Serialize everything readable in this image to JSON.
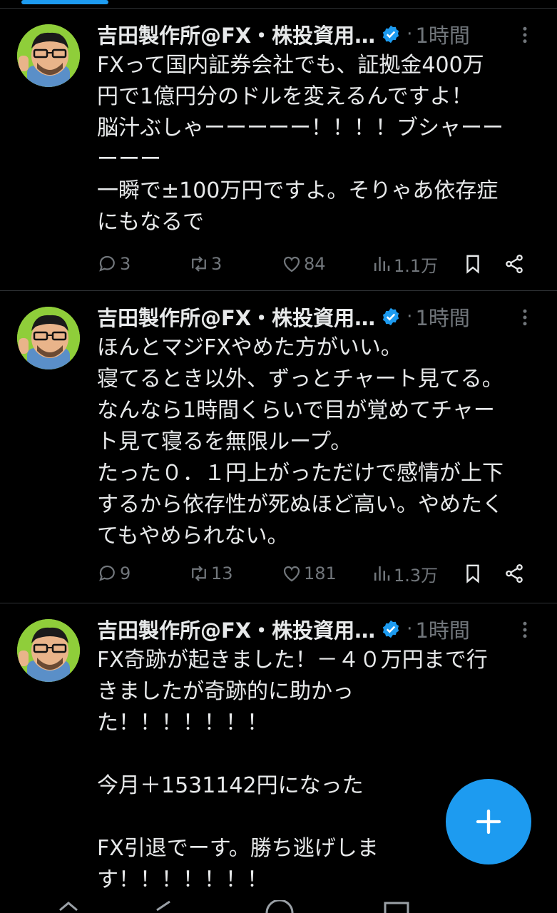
{
  "colors": {
    "background": "#000000",
    "accent": "#1d9bf0",
    "text": "#e7e9ea",
    "muted": "#71767b",
    "divider": "#2f3336"
  },
  "tweets": [
    {
      "author": "吉田製作所@FX・株投資用…",
      "time": "1時間",
      "text": "FXって国内証券会社でも、証拠金400万\n円で1億円分のドルを変えるんですよ！\n脳汁ぶしゃーーーーー！！！！ブシャーー\nーーー\n一瞬で±100万円ですよ。そりゃあ依存症\nにもなるで",
      "replies": "3",
      "retweets": "3",
      "likes": "84",
      "views": "1.1万"
    },
    {
      "author": "吉田製作所@FX・株投資用…",
      "time": "1時間",
      "text": "ほんとマジFXやめた方がいい。\n寝てるとき以外、ずっとチャート見てる。\nなんなら1時間くらいで目が覚めてチャー\nト見て寝るを無限ループ。\nたった０．１円上がっただけで感情が上下\nするから依存性が死ぬほど高い。やめたく\nてもやめられない。",
      "replies": "9",
      "retweets": "13",
      "likes": "181",
      "views": "1.3万"
    },
    {
      "author": "吉田製作所@FX・株投資用…",
      "time": "1時間",
      "text": "FX奇跡が起きました！－４０万円まで行\nきましたが奇跡的に助かっ\nた！！！！！！！\n\n今月＋1531142円になった\n\nFX引退でーす。勝ち逃げしま\nす！！！！！！！"
    }
  ],
  "icons": {
    "reply": "comment-icon",
    "retweet": "retweet-icon",
    "like": "heart-icon",
    "views": "views-icon",
    "bookmark": "bookmark-icon",
    "share": "share-icon",
    "verified": "verified-badge-icon",
    "more": "more-vertical-icon",
    "compose": "plus-icon"
  }
}
